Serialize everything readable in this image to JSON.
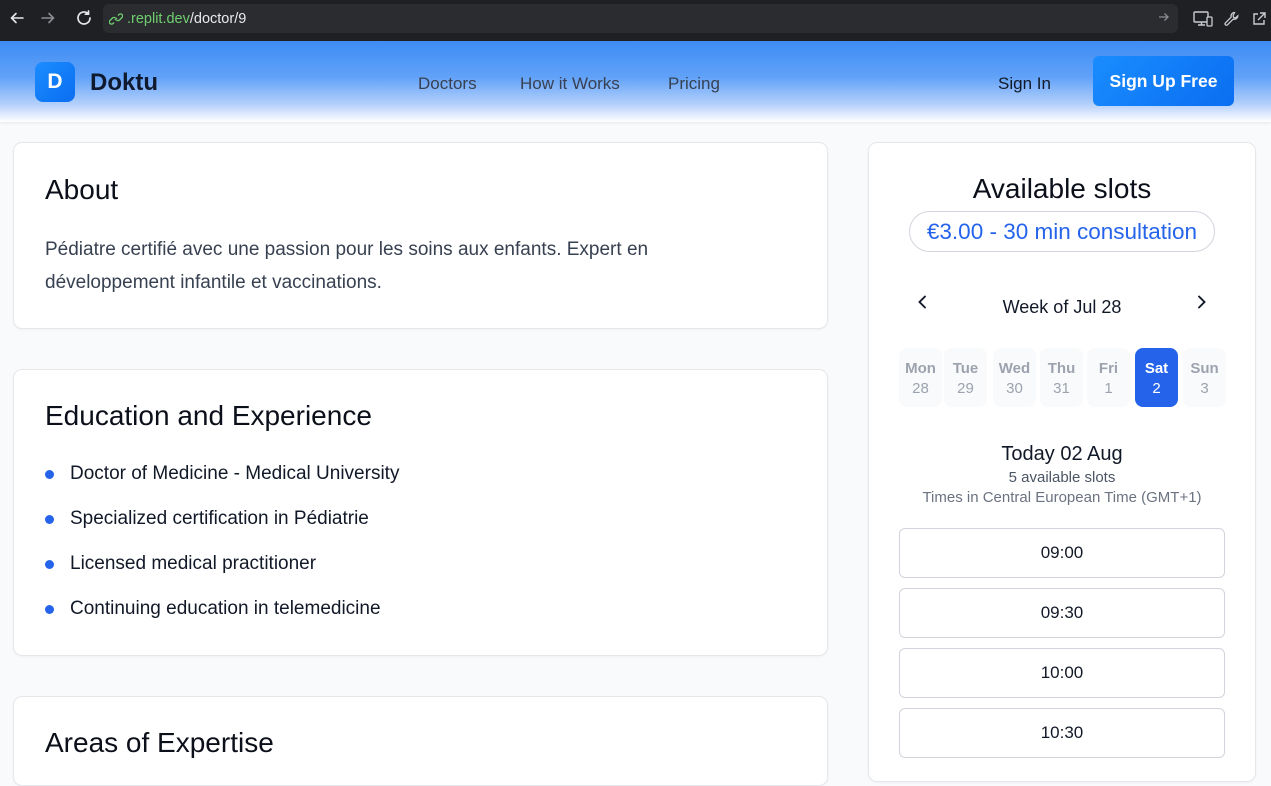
{
  "browser": {
    "url_host": ".replit.dev",
    "url_path": "/doctor/9"
  },
  "header": {
    "logo_letter": "D",
    "brand": "Doktu",
    "nav": [
      "Doctors",
      "How it Works",
      "Pricing"
    ],
    "sign_in": "Sign In",
    "sign_up": "Sign Up Free"
  },
  "about": {
    "title": "About",
    "text": "Pédiatre certifié avec une passion pour les soins aux enfants. Expert en développement infantile et vaccinations."
  },
  "education": {
    "title": "Education and Experience",
    "items": [
      "Doctor of Medicine - Medical University",
      "Specialized certification in Pédiatrie",
      "Licensed medical practitioner",
      "Continuing education in telemedicine"
    ]
  },
  "expertise": {
    "title": "Areas of Expertise"
  },
  "slots": {
    "title": "Available slots",
    "price": "€3.00 - 30 min consultation",
    "week_label": "Week of Jul 28",
    "days": [
      {
        "name": "Mon",
        "date": "28"
      },
      {
        "name": "Tue",
        "date": "29"
      },
      {
        "name": "Wed",
        "date": "30"
      },
      {
        "name": "Thu",
        "date": "31"
      },
      {
        "name": "Fri",
        "date": "1"
      },
      {
        "name": "Sat",
        "date": "2"
      },
      {
        "name": "Sun",
        "date": "3"
      }
    ],
    "selected_day": "Sat",
    "today_title": "Today 02 Aug",
    "available_count": "5 available slots",
    "timezone_note": "Times in Central European Time (GMT+1)",
    "times": [
      "09:00",
      "09:30",
      "10:00",
      "10:30"
    ]
  },
  "colors": {
    "accent": "#2563eb",
    "brand": "#0a6ef0"
  }
}
